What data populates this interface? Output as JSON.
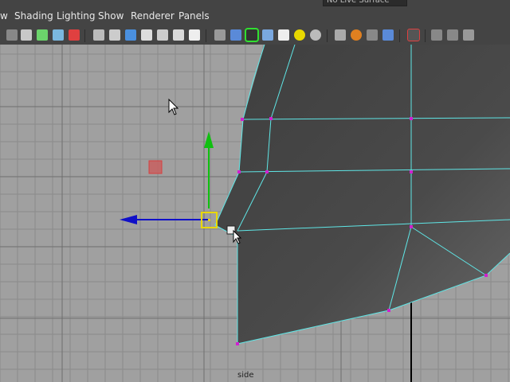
{
  "status_line": {
    "live_surface_label": "No Live Surface"
  },
  "menubar": {
    "items": [
      "w",
      "Shading",
      "Lighting",
      "Show",
      "Renderer",
      "Panels"
    ]
  },
  "toolbar": {
    "icons": [
      "select-camera-icon",
      "camera-attributes-icon",
      "bookmark-icon",
      "image-plane-icon",
      "grease-pencil-icon",
      "grid-icon",
      "film-gate-icon",
      "resolution-gate-icon",
      "gate-mask-icon",
      "field-chart-icon",
      "safe-action-icon",
      "safe-title-icon",
      "wireframe-icon",
      "smooth-shade-icon",
      "wireframe-on-shaded-icon",
      "xray-icon",
      "textured-icon",
      "lighting-default-icon",
      "use-all-lights-icon",
      "shadows-icon",
      "ambient-occlusion-icon",
      "motion-blur-icon",
      "anti-aliasing-icon",
      "isolate-select-icon",
      "xray-joints-icon",
      "xray-active-icon",
      "hud-icon"
    ]
  },
  "viewport": {
    "camera_label": "side",
    "colors": {
      "background": "#a0a0a0",
      "grid": "#8a8a8a",
      "axis": "#000000",
      "mesh_face": "#4a4a4a",
      "mesh_edge": "#5fe6e6",
      "vertex": "#d020d0",
      "manipulator_x": "#1010c8",
      "manipulator_y": "#10c010",
      "manipulator_center": "#e8d800"
    }
  }
}
